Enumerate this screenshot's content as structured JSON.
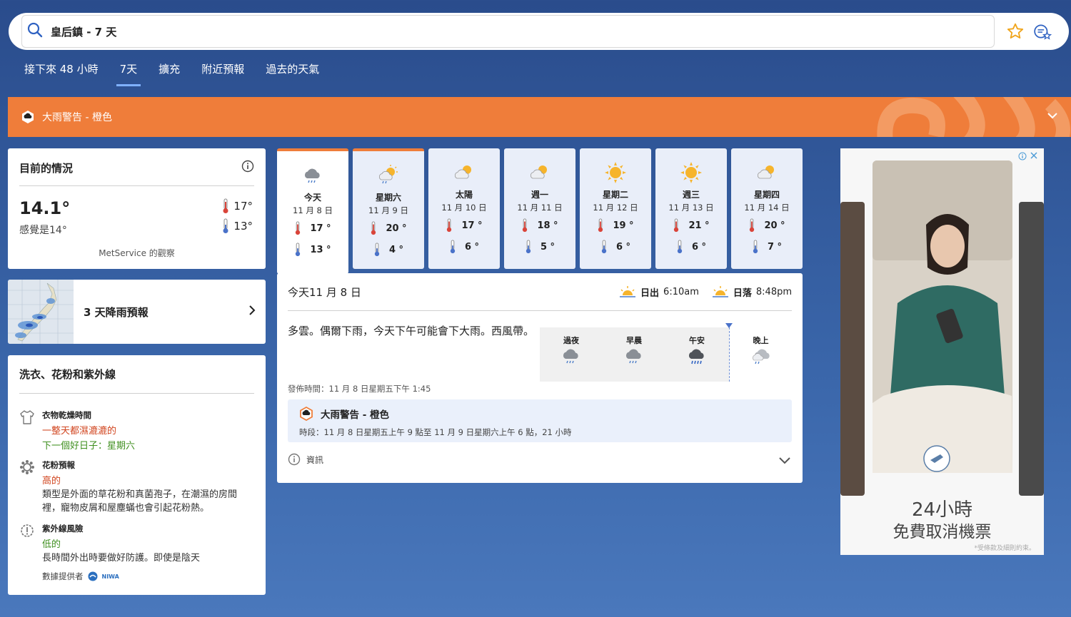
{
  "search": {
    "value": "皇后鎮 - 7 天"
  },
  "tabs": [
    {
      "label": "接下來 48 小時"
    },
    {
      "label": "7天",
      "active": true
    },
    {
      "label": "擴充"
    },
    {
      "label": "附近預報"
    },
    {
      "label": "過去的天氣"
    }
  ],
  "warning_banner": {
    "label": "大雨警告 - 橙色",
    "color": "#ef7d3a"
  },
  "current": {
    "title": "目前的情況",
    "temp": "14.1°",
    "feels_like": "感覺是14°",
    "high": "17°",
    "low": "13°",
    "source": "MetService 的觀察"
  },
  "rain_forecast": {
    "label": "3 天降雨預報"
  },
  "laundry": {
    "title": "洗衣、花粉和紫外線",
    "drying": {
      "heading": "衣物乾燥時間",
      "status": "一整天都濕漉漉的",
      "next_good": "下一個好日子：星期六"
    },
    "pollen": {
      "heading": "花粉預報",
      "level": "高的",
      "desc": "類型是外面的草花粉和真菌孢子，在潮濕的房間裡，寵物皮屑和屋塵蟎也會引起花粉熱。"
    },
    "uv": {
      "heading": "紫外線風險",
      "level": "低的",
      "desc": "長時間外出時要做好防護。即使是陰天"
    },
    "provider": "數據提供者",
    "provider_logo": "NIWA"
  },
  "days": [
    {
      "name": "今天",
      "date": "11 月 8 日",
      "high": "17 °",
      "low": "13 °",
      "icon": "rain-cloud-icon",
      "today": true
    },
    {
      "name": "星期六",
      "date": "11 月 9 日",
      "high": "20 °",
      "low": "4 °",
      "icon": "sun-rain-icon",
      "warn": true
    },
    {
      "name": "太陽",
      "date": "11 月 10 日",
      "high": "17 °",
      "low": "6 °",
      "icon": "partly-cloudy-icon"
    },
    {
      "name": "週一",
      "date": "11 月 11 日",
      "high": "18 °",
      "low": "5 °",
      "icon": "partly-cloudy-icon"
    },
    {
      "name": "星期二",
      "date": "11 月 12 日",
      "high": "19 °",
      "low": "6 °",
      "icon": "sun-icon"
    },
    {
      "name": "週三",
      "date": "11 月 13 日",
      "high": "21 °",
      "low": "6 °",
      "icon": "sun-icon"
    },
    {
      "name": "星期四",
      "date": "11 月 14 日",
      "high": "20 °",
      "low": "7 °",
      "icon": "partly-cloudy-icon"
    }
  ],
  "detail": {
    "heading": "今天11 月 8 日",
    "sunrise_label": "日出",
    "sunrise": "6:10am",
    "sunset_label": "日落",
    "sunset": "8:48pm",
    "description": "多雲。偶爾下雨，今天下午可能會下大雨。西風帶。",
    "periods": [
      {
        "label": "過夜",
        "icon": "rain-cloud-icon"
      },
      {
        "label": "早晨",
        "icon": "rain-cloud-icon"
      },
      {
        "label": "午安",
        "icon": "heavy-rain-icon"
      },
      {
        "label": "晚上",
        "icon": "showers-icon"
      }
    ],
    "issued": "發佈時間：11 月 8 日星期五下午 1:45",
    "warning_title": "大雨警告 - 橙色",
    "warning_period": "時段：11 月 8 日星期五上午 9 點至 11 月 9 日星期六上午 6 點，21 小時",
    "info_label": "資訊"
  },
  "ad": {
    "line1": "24小時",
    "line2": "免費取消機票",
    "fine_print": "*受條款及細則約束。"
  }
}
